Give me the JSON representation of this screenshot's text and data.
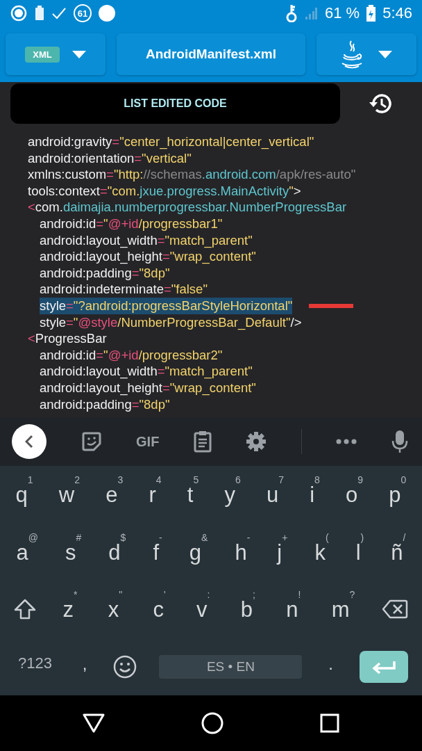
{
  "status_bar": {
    "notification_count": "61",
    "battery": "61 %",
    "time": "5:46"
  },
  "toolbar": {
    "language_badge": "XML",
    "file_name": "AndroidManifest.xml"
  },
  "list_button": "LIST EDITED CODE",
  "code_lines": [
    {
      "selected": false,
      "segments": [
        {
          "text": "android:gravity",
          "kind": "plain"
        },
        {
          "text": "=",
          "kind": "punct"
        },
        {
          "text": "\"center_horizontal|center_vertical\"",
          "kind": "string"
        }
      ]
    },
    {
      "selected": false,
      "segments": [
        {
          "text": "android:orientation",
          "kind": "plain"
        },
        {
          "text": "=",
          "kind": "punct"
        },
        {
          "text": "\"vertical\"",
          "kind": "string"
        }
      ]
    },
    {
      "selected": false,
      "segments": [
        {
          "text": "xmlns:custom",
          "kind": "plain"
        },
        {
          "text": "=",
          "kind": "punct"
        },
        {
          "text": "\"http:",
          "kind": "string"
        },
        {
          "text": "//schemas",
          "kind": "faded"
        },
        {
          "text": ".android.com",
          "kind": "link"
        },
        {
          "text": "/apk/res-auto\"",
          "kind": "faded"
        }
      ]
    },
    {
      "selected": false,
      "segments": [
        {
          "text": "tools:context",
          "kind": "plain"
        },
        {
          "text": "=",
          "kind": "punct"
        },
        {
          "text": "\"com.",
          "kind": "string"
        },
        {
          "text": "jxue.progress.MainActivity",
          "kind": "link"
        },
        {
          "text": "\"",
          "kind": "string"
        },
        {
          "text": ">",
          "kind": "plain"
        }
      ]
    },
    {
      "selected": false,
      "segments": [
        {
          "text": "<",
          "kind": "punct"
        },
        {
          "text": "com.",
          "kind": "plain"
        },
        {
          "text": "daimajia.numberprogressbar.NumberProgressBar",
          "kind": "link"
        }
      ],
      "children": [
        {
          "selected": false,
          "segments": [
            {
              "text": "android:id",
              "kind": "plain"
            },
            {
              "text": "=",
              "kind": "punct"
            },
            {
              "text": "\"",
              "kind": "string"
            },
            {
              "text": "@+id",
              "kind": "punct"
            },
            {
              "text": "/progressbar1\"",
              "kind": "string"
            }
          ]
        },
        {
          "selected": false,
          "segments": [
            {
              "text": "android:layout_width",
              "kind": "plain"
            },
            {
              "text": "=",
              "kind": "punct"
            },
            {
              "text": "\"match_parent\"",
              "kind": "string"
            }
          ]
        },
        {
          "selected": false,
          "segments": [
            {
              "text": "android:layout_height",
              "kind": "plain"
            },
            {
              "text": "=",
              "kind": "punct"
            },
            {
              "text": "\"wrap_content\"",
              "kind": "string"
            }
          ]
        },
        {
          "selected": false,
          "segments": [
            {
              "text": "android:padding",
              "kind": "plain"
            },
            {
              "text": "=",
              "kind": "punct"
            },
            {
              "text": "\"8dp\"",
              "kind": "string"
            }
          ]
        },
        {
          "selected": false,
          "segments": [
            {
              "text": "android:indeterminate",
              "kind": "plain"
            },
            {
              "text": "=",
              "kind": "punct"
            },
            {
              "text": "\"false\"",
              "kind": "string"
            }
          ]
        },
        {
          "selected": true,
          "segments": [
            {
              "text": "style",
              "kind": "plain"
            },
            {
              "text": "=",
              "kind": "punct"
            },
            {
              "text": "\"?android:progressBarStyleHorizontal\"",
              "kind": "string"
            }
          ]
        },
        {
          "selected": false,
          "segments": [
            {
              "text": "style",
              "kind": "plain"
            },
            {
              "text": "=",
              "kind": "punct"
            },
            {
              "text": "\"",
              "kind": "string"
            },
            {
              "text": "@style",
              "kind": "punct"
            },
            {
              "text": "/NumberProgressBar_Default\"",
              "kind": "string"
            },
            {
              "text": "/>",
              "kind": "plain"
            }
          ]
        }
      ]
    },
    {
      "selected": false,
      "segments": [
        {
          "text": "<",
          "kind": "punct"
        },
        {
          "text": "ProgressBar",
          "kind": "plain"
        }
      ],
      "children": [
        {
          "selected": false,
          "segments": [
            {
              "text": "android:id",
              "kind": "plain"
            },
            {
              "text": "=",
              "kind": "punct"
            },
            {
              "text": "\"",
              "kind": "string"
            },
            {
              "text": "@+id",
              "kind": "punct"
            },
            {
              "text": "/progressbar2\"",
              "kind": "string"
            }
          ]
        },
        {
          "selected": false,
          "segments": [
            {
              "text": "android:layout_width",
              "kind": "plain"
            },
            {
              "text": "=",
              "kind": "punct"
            },
            {
              "text": "\"match_parent\"",
              "kind": "string"
            }
          ]
        },
        {
          "selected": false,
          "segments": [
            {
              "text": "android:layout_height",
              "kind": "plain"
            },
            {
              "text": "=",
              "kind": "punct"
            },
            {
              "text": "\"wrap_content\"",
              "kind": "string"
            }
          ]
        },
        {
          "selected": false,
          "segments": [
            {
              "text": "android:padding",
              "kind": "plain"
            },
            {
              "text": "=",
              "kind": "punct"
            },
            {
              "text": "\"8dp\"",
              "kind": "string"
            }
          ]
        }
      ]
    }
  ],
  "keyboard": {
    "gif": "GIF",
    "letter_rows": [
      [
        {
          "label": "q",
          "hint": "1"
        },
        {
          "label": "w",
          "hint": "2"
        },
        {
          "label": "e",
          "hint": "3"
        },
        {
          "label": "r",
          "hint": "4"
        },
        {
          "label": "t",
          "hint": "5"
        },
        {
          "label": "y",
          "hint": "6"
        },
        {
          "label": "u",
          "hint": "7"
        },
        {
          "label": "i",
          "hint": "8"
        },
        {
          "label": "o",
          "hint": "9"
        },
        {
          "label": "p",
          "hint": "0"
        }
      ],
      [
        {
          "label": "a",
          "hint": "@"
        },
        {
          "label": "s",
          "hint": "#"
        },
        {
          "label": "d",
          "hint": "$"
        },
        {
          "label": "f",
          "hint": "-"
        },
        {
          "label": "g",
          "hint": "&"
        },
        {
          "label": "h",
          "hint": "-"
        },
        {
          "label": "j",
          "hint": "+"
        },
        {
          "label": "k",
          "hint": "("
        },
        {
          "label": "l",
          "hint": ")"
        },
        {
          "label": "ñ",
          "hint": "/"
        }
      ],
      [
        {
          "label": "z",
          "hint": "*"
        },
        {
          "label": "x",
          "hint": "\""
        },
        {
          "label": "c",
          "hint": "'"
        },
        {
          "label": "v",
          "hint": ":"
        },
        {
          "label": "b",
          "hint": ";"
        },
        {
          "label": "n",
          "hint": "!"
        },
        {
          "label": "m",
          "hint": "?"
        }
      ]
    ],
    "symbols_key": "?123",
    "comma_key": ",",
    "space_key": "ES • EN",
    "period_key": "."
  }
}
